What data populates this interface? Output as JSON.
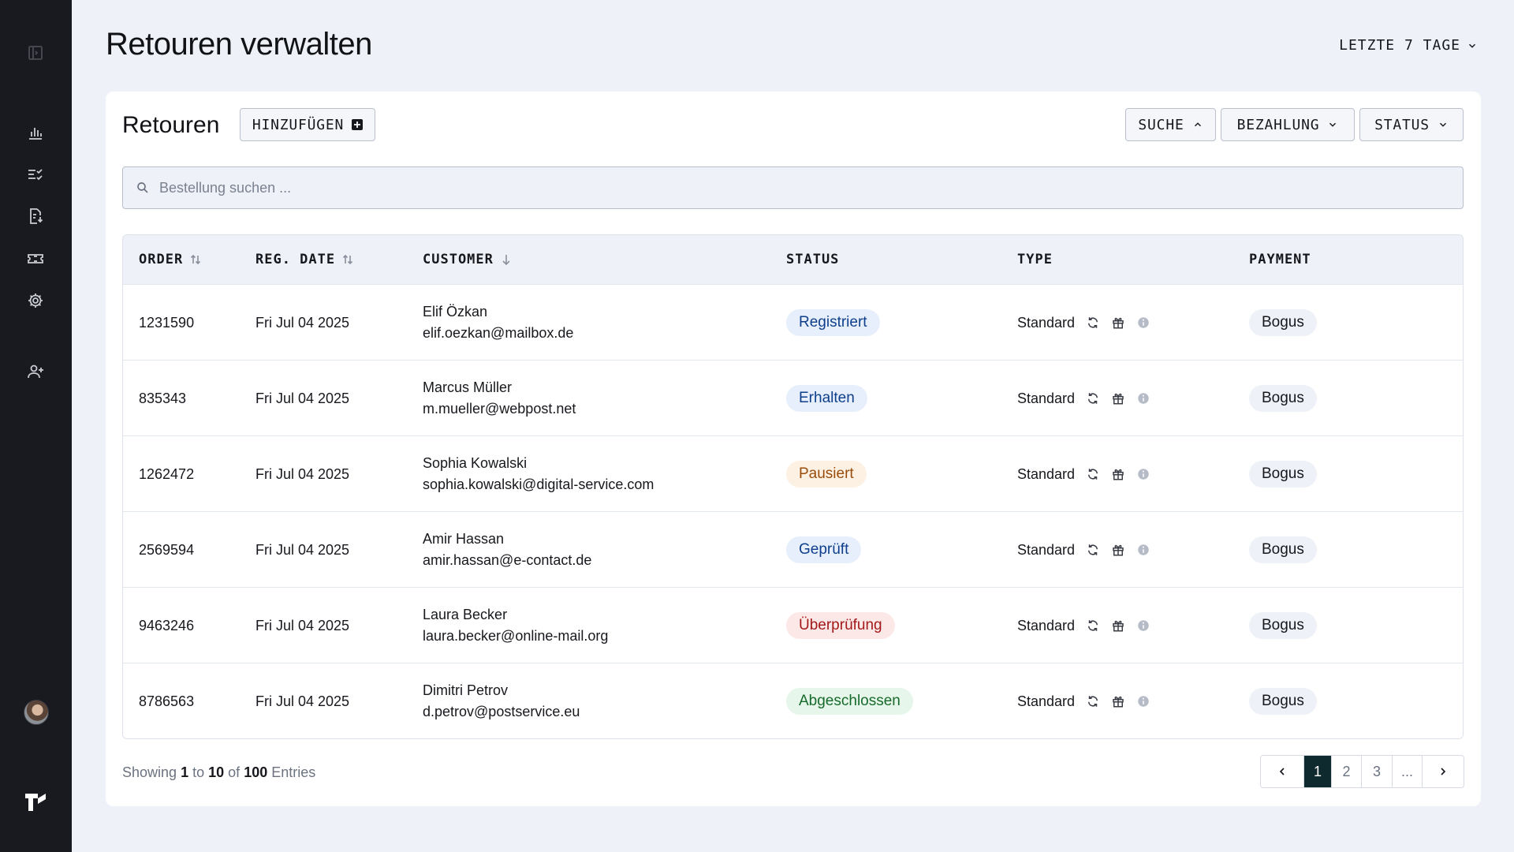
{
  "header": {
    "title": "Retouren verwalten",
    "range_label": "LETZTE 7 TAGE"
  },
  "card": {
    "title": "Retouren",
    "add_label": "HINZUFÜGEN",
    "filters": {
      "search": "SUCHE",
      "payment": "BEZAHLUNG",
      "status": "STATUS"
    },
    "search_placeholder": "Bestellung suchen ..."
  },
  "table": {
    "columns": {
      "order": "ORDER",
      "reg_date": "REG. DATE",
      "customer": "CUSTOMER",
      "status": "STATUS",
      "type": "TYPE",
      "payment": "PAYMENT"
    },
    "rows": [
      {
        "order": "1231590",
        "date": "Fri Jul 04 2025",
        "name": "Elif Özkan",
        "email": "elif.oezkan@mailbox.de",
        "status": "Registriert",
        "status_bg": "#e6effb",
        "status_fg": "#0f3f8c",
        "type": "Standard",
        "payment": "Bogus"
      },
      {
        "order": "835343",
        "date": "Fri Jul 04 2025",
        "name": "Marcus Müller",
        "email": "m.mueller@webpost.net",
        "status": "Erhalten",
        "status_bg": "#e6effb",
        "status_fg": "#0f3f8c",
        "type": "Standard",
        "payment": "Bogus"
      },
      {
        "order": "1262472",
        "date": "Fri Jul 04 2025",
        "name": "Sophia Kowalski",
        "email": "sophia.kowalski@digital-service.com",
        "status": "Pausiert",
        "status_bg": "#fdf1e4",
        "status_fg": "#9a4d0a",
        "type": "Standard",
        "payment": "Bogus"
      },
      {
        "order": "2569594",
        "date": "Fri Jul 04 2025",
        "name": "Amir Hassan",
        "email": "amir.hassan@e-contact.de",
        "status": "Geprüft",
        "status_bg": "#e6effb",
        "status_fg": "#0f3f8c",
        "type": "Standard",
        "payment": "Bogus"
      },
      {
        "order": "9463246",
        "date": "Fri Jul 04 2025",
        "name": "Laura Becker",
        "email": "laura.becker@online-mail.org",
        "status": "Überprüfung",
        "status_bg": "#fde8e8",
        "status_fg": "#a31919",
        "type": "Standard",
        "payment": "Bogus"
      },
      {
        "order": "8786563",
        "date": "Fri Jul 04 2025",
        "name": "Dimitri Petrov",
        "email": "d.petrov@postservice.eu",
        "status": "Abgeschlossen",
        "status_bg": "#e7f6ea",
        "status_fg": "#166b2c",
        "type": "Standard",
        "payment": "Bogus"
      }
    ]
  },
  "footer": {
    "showing_prefix": "Showing",
    "from": "1",
    "to_word": "to",
    "to": "10",
    "of_word": "of",
    "total": "100",
    "suffix": "Entries",
    "pages": [
      "1",
      "2",
      "3",
      "..."
    ]
  },
  "icons": {
    "sidebar": [
      "sidebar-toggle-icon",
      "bar-chart-icon",
      "checklist-icon",
      "document-download-icon",
      "ticket-icon",
      "gear-icon",
      "add-user-icon"
    ],
    "type": [
      "refresh-icon",
      "gift-icon",
      "info-icon"
    ]
  },
  "colors": {
    "sidebar_bg": "#191a20",
    "page_bg": "#eef1f7",
    "active_page": "#0f2a2e"
  }
}
